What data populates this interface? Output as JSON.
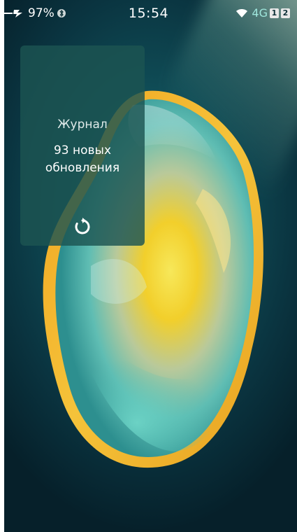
{
  "status_bar": {
    "battery_percent": "97%",
    "time": "15:54",
    "network_type": "4G",
    "sim1_label": "1",
    "sim2_label": "2",
    "icons": [
      "charging-plug-icon",
      "bluetooth-icon",
      "wifi-icon",
      "signal-icon"
    ]
  },
  "widget": {
    "title": "Журнал",
    "updates_text": "93 новых\nобновления",
    "refresh_icon": "refresh-icon"
  },
  "colors": {
    "background_teal": "#0f4b55",
    "widget_bg": "#1c5452",
    "crystal_yellow": "#f3d12a",
    "network_accent": "#9fe6dc"
  }
}
